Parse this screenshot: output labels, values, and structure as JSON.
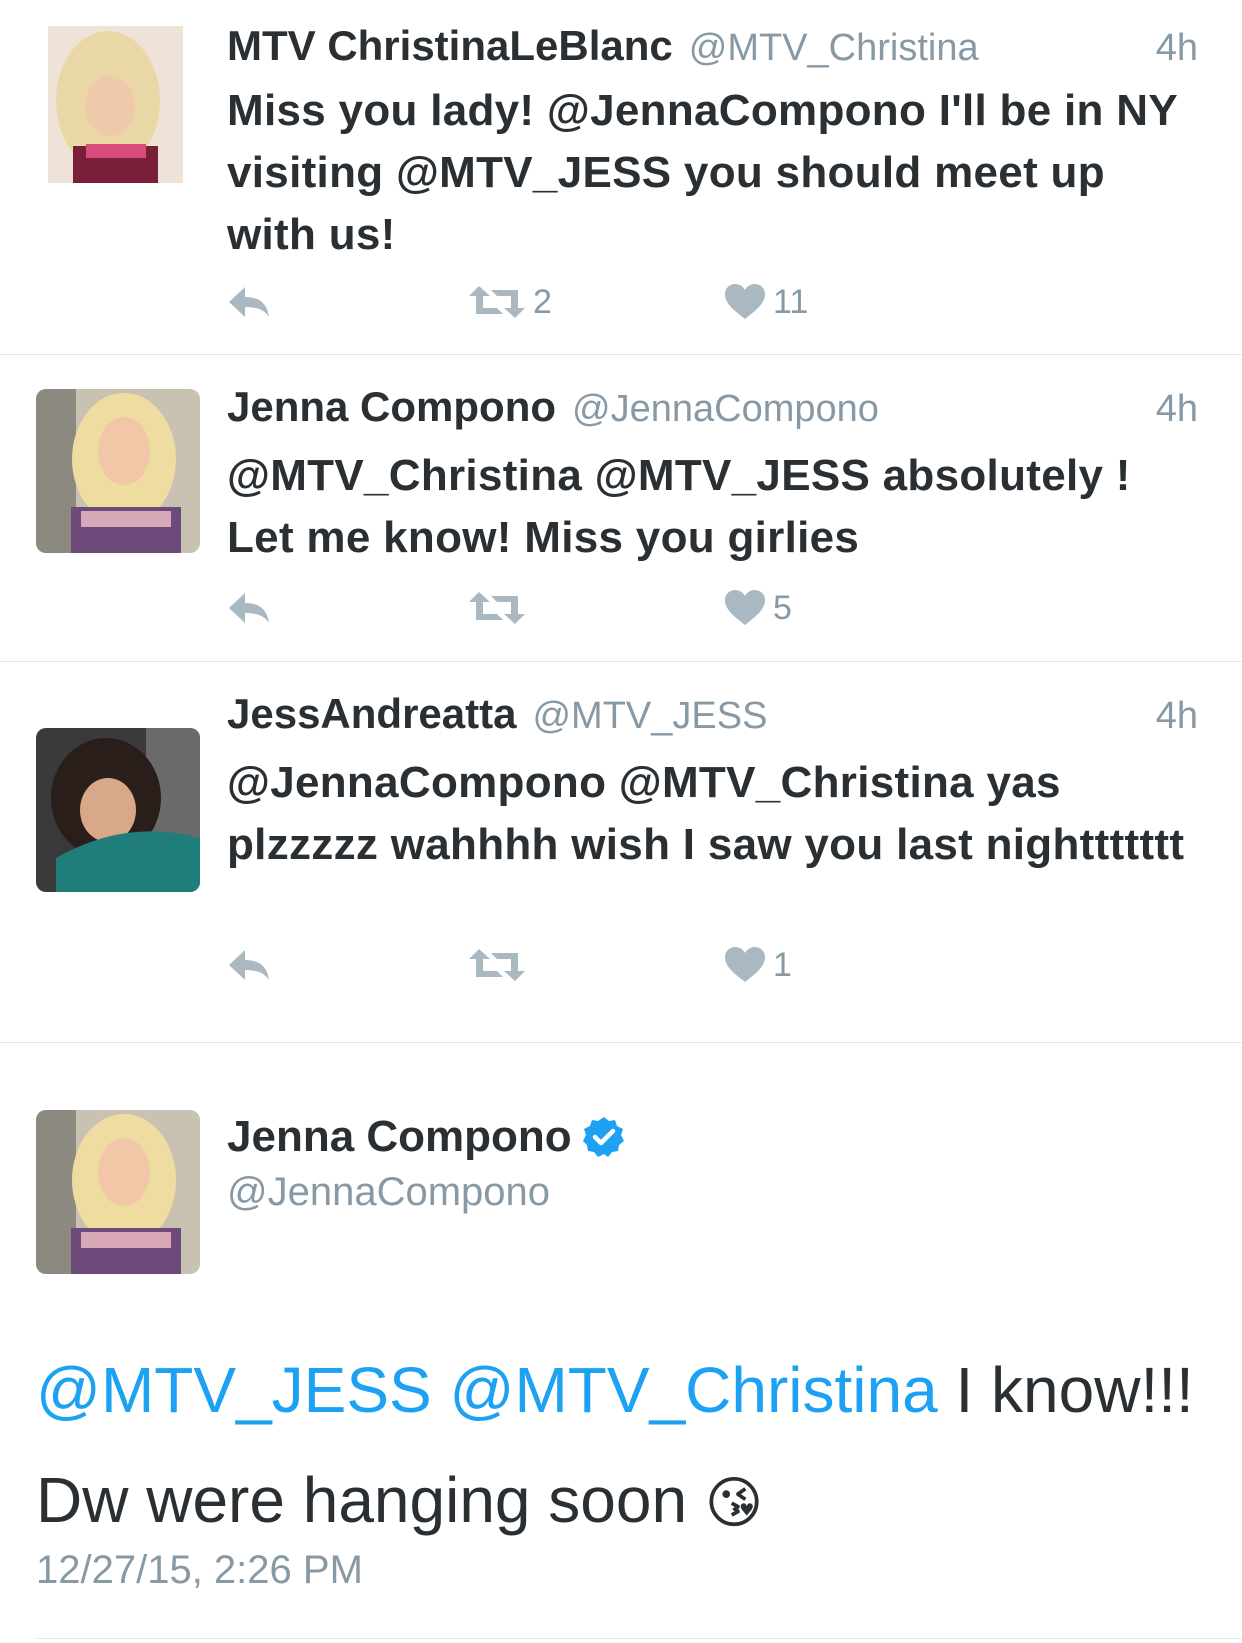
{
  "colors": {
    "mention": "#1da1f2",
    "meta": "#8899a6",
    "text": "#292f33",
    "divider": "#e1e8ed"
  },
  "replies": [
    {
      "name": "MTV ChristinaLeBlanc",
      "handle": "@MTV_Christina",
      "time": "4h",
      "text": "Miss you lady! @JennaCompono I'll be in NY visiting @MTV_JESS you should meet up with us!",
      "retweets": "2",
      "likes": "11",
      "icons": [
        "reply-icon",
        "retweet-icon",
        "like-icon"
      ]
    },
    {
      "name": "Jenna Compono",
      "handle": "@JennaCompono",
      "time": "4h",
      "text": "@MTV_Christina @MTV_JESS absolutely ! Let me know! Miss you girlies",
      "retweets": "",
      "likes": "5",
      "icons": [
        "reply-icon",
        "retweet-icon",
        "like-icon"
      ]
    },
    {
      "name": "JessAndreatta",
      "handle": "@MTV_JESS",
      "time": "4h",
      "text": "@JennaCompono @MTV_Christina yas plzzzzz wahhhh wish I saw you last nighttttttt",
      "retweets": "",
      "likes": "1",
      "icons": [
        "reply-icon",
        "retweet-icon",
        "like-icon"
      ]
    }
  ],
  "detail": {
    "name": "Jenna Compono",
    "handle": "@JennaCompono",
    "verified_icon": "verified-badge-icon",
    "mention_1": "@MTV_JESS",
    "mention_2": "@MTV_Christina",
    "text_rest": "I know!!! Dw were hanging soon",
    "emoji": "😘",
    "date": "12/27/15, 2:26 PM"
  }
}
